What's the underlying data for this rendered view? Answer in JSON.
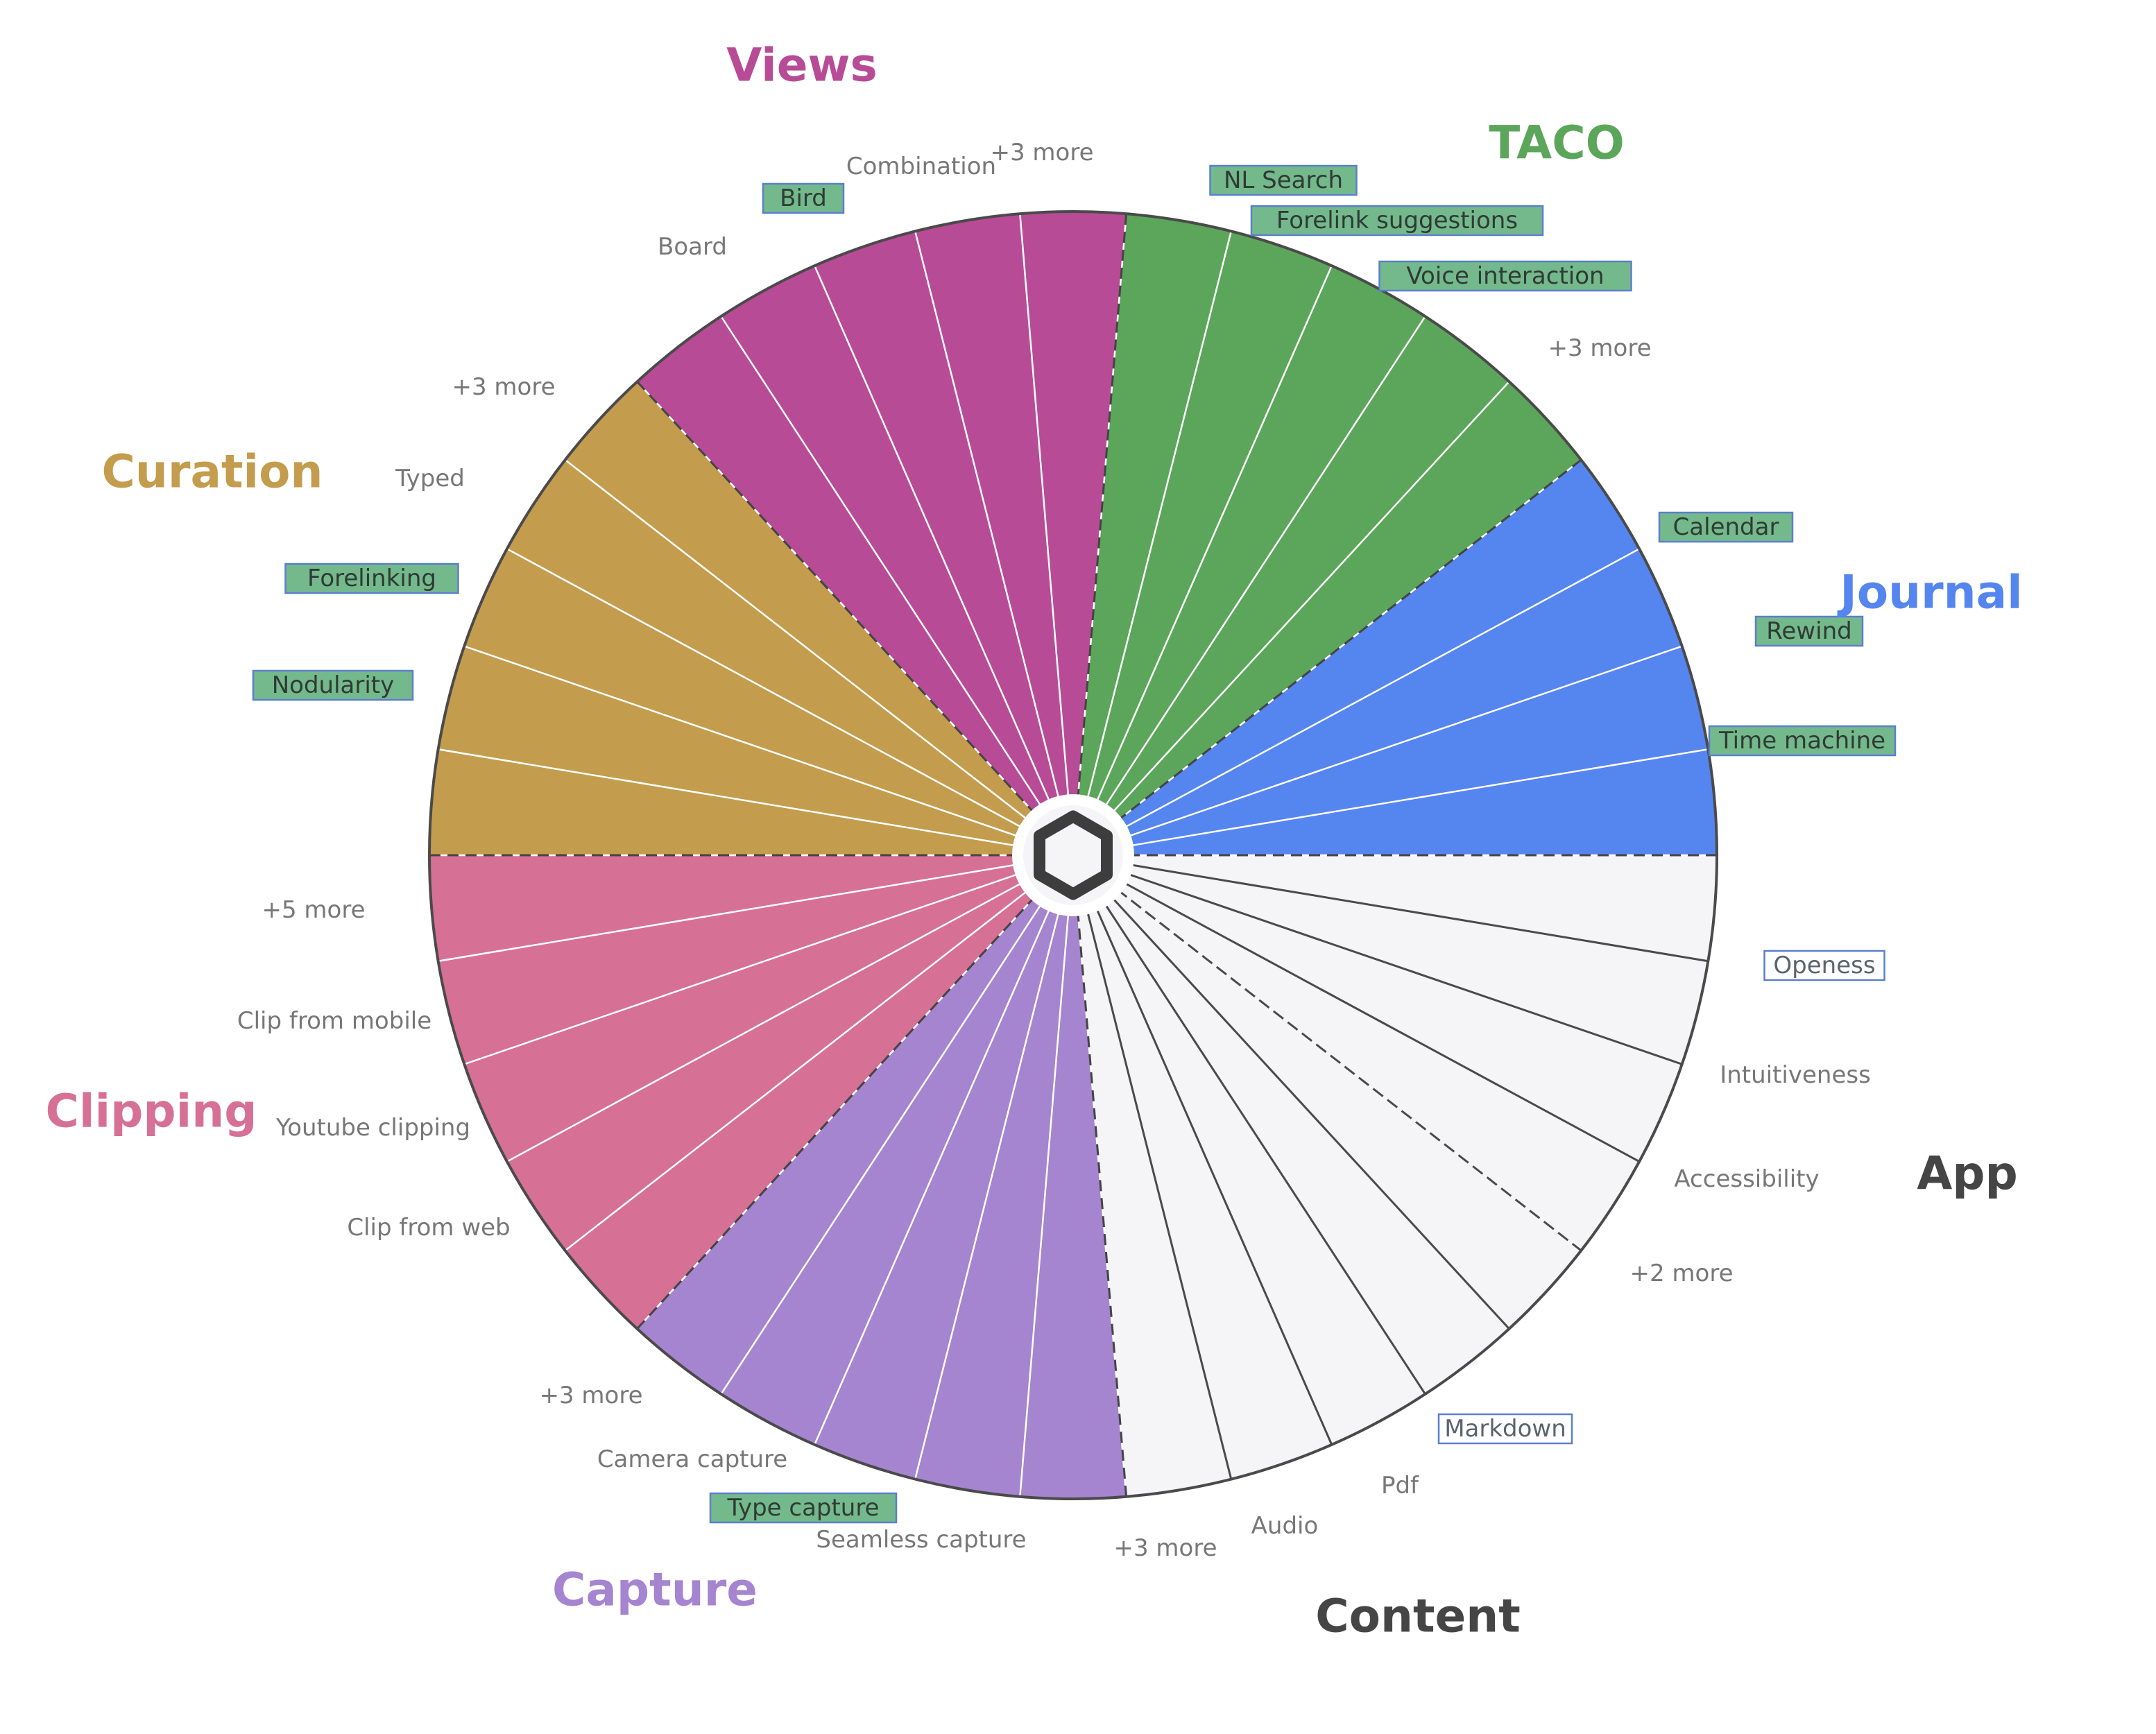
{
  "center_icon": "hexagon-logo-icon",
  "colors": {
    "wedge_divider": "#ffffff",
    "app_content_divider": "#4a4a4a",
    "outline": "#4a4a4a",
    "green_box_fill": "#74b98b",
    "box_border": "#5b7fcf"
  },
  "categories": [
    {
      "id": "journal",
      "title": "Journal",
      "color": "#5585ee",
      "wedges": 4,
      "items": [
        {
          "text": "Calendar",
          "style": "green-box"
        },
        {
          "text": "Rewind",
          "style": "green-box"
        },
        {
          "text": "Time machine",
          "style": "green-box"
        }
      ]
    },
    {
      "id": "taco",
      "title": "TACO",
      "color": "#5ba65a",
      "wedges": 5,
      "items": [
        {
          "text": "NL Search",
          "style": "green-box"
        },
        {
          "text": "Forelink suggestions",
          "style": "green-box"
        },
        {
          "text": "Voice interaction",
          "style": "green-box"
        },
        {
          "text": "+3 more",
          "style": "plain"
        }
      ]
    },
    {
      "id": "views",
      "title": "Views",
      "color": "#b84b96",
      "wedges": 5,
      "items": [
        {
          "text": "+3 more",
          "style": "plain"
        },
        {
          "text": "Combination",
          "style": "plain"
        },
        {
          "text": "Bird",
          "style": "green-box"
        },
        {
          "text": "Board",
          "style": "plain"
        }
      ]
    },
    {
      "id": "curation",
      "title": "Curation",
      "color": "#c49c4e",
      "wedges": 5,
      "items": [
        {
          "text": "+3 more",
          "style": "plain"
        },
        {
          "text": "Typed",
          "style": "plain"
        },
        {
          "text": "Forelinking",
          "style": "green-box"
        },
        {
          "text": "Nodularity",
          "style": "green-box"
        }
      ]
    },
    {
      "id": "clipping",
      "title": "Clipping",
      "color": "#d77095",
      "wedges": 5,
      "items": [
        {
          "text": "+5 more",
          "style": "plain"
        },
        {
          "text": "Clip from mobile",
          "style": "plain"
        },
        {
          "text": "Youtube clipping",
          "style": "plain"
        },
        {
          "text": "Clip from web",
          "style": "plain"
        }
      ]
    },
    {
      "id": "capture",
      "title": "Capture",
      "color": "#a584d0",
      "wedges": 5,
      "items": [
        {
          "text": "+3 more",
          "style": "plain"
        },
        {
          "text": "Camera capture",
          "style": "plain"
        },
        {
          "text": "Type capture",
          "style": "green-box"
        },
        {
          "text": "Seamless capture",
          "style": "plain"
        }
      ]
    },
    {
      "id": "content",
      "title": "Content",
      "color": "#f5f5f7",
      "wedges": 5,
      "items": [
        {
          "text": "+3 more",
          "style": "plain"
        },
        {
          "text": "Audio",
          "style": "plain"
        },
        {
          "text": "Pdf",
          "style": "plain"
        },
        {
          "text": "Markdown",
          "style": "outline-box"
        }
      ]
    },
    {
      "id": "app",
      "title": "App",
      "color": "#f5f5f7",
      "wedges": 4,
      "items": [
        {
          "text": "Openess",
          "style": "outline-box"
        },
        {
          "text": "Intuitiveness",
          "style": "plain"
        },
        {
          "text": "Accessibility",
          "style": "plain"
        },
        {
          "text": "+2 more",
          "style": "plain"
        }
      ]
    }
  ]
}
